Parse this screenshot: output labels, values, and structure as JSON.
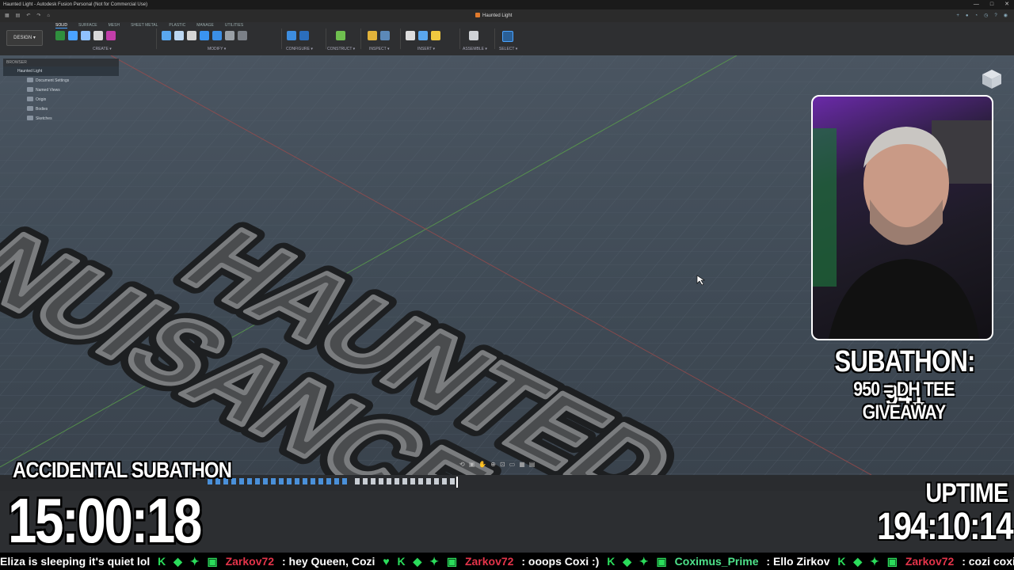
{
  "window": {
    "title": "Haunted Light - Autodesk Fusion Personal (Not for Commercial Use)",
    "controls": [
      "—",
      "□",
      "✕"
    ]
  },
  "tab": {
    "document": "Haunted Light"
  },
  "toolbar": {
    "design_label": "DESIGN ▾",
    "workspace_tabs": [
      "SOLID",
      "SURFACE",
      "MESH",
      "SHEET METAL",
      "PLASTIC",
      "MANAGE",
      "UTILITIES"
    ],
    "groups": [
      "CREATE ▾",
      "MODIFY ▾",
      "CONFIGURE ▾",
      "CONSTRUCT ▾",
      "INSPECT ▾",
      "INSERT ▾",
      "ASSEMBLE ▾",
      "SELECT ▾"
    ]
  },
  "browser": {
    "header": "BROWSER",
    "root": "Haunted Light",
    "items": [
      "Document Settings",
      "Named Views",
      "Origin",
      "Bodies",
      "Sketches"
    ]
  },
  "model": {
    "line1": "HAUNTED",
    "line2": "NUISANCE"
  },
  "overlay": {
    "subathon_count": "SUBATHON: 941",
    "giveaway": "950 = DH TEE GIVEAWAY",
    "accidental_title": "ACCIDENTAL SUBATHON",
    "accidental_timer": "15:00:18",
    "uptime_label": "UPTIME",
    "uptime_value": "194:10:14"
  },
  "ticker": {
    "m0": "Eliza is sleeping it's quiet lol",
    "u1": "Zarkov72",
    "m1": ": hey Queen, Cozi",
    "u2": "Zarkov72",
    "m2": ": ooops Coxi :)",
    "u3": "Coximus_Prime",
    "m3": ": Ello Zirkov",
    "u4": "Zarkov72",
    "m4": ": cozi coxi :)"
  },
  "colors": {
    "accent": "#4aa3ff",
    "viewport_bg": "#44505c",
    "model_gray": "#6e6e6e",
    "ticker_user": "#e4344a",
    "ticker_user_alt": "#4ee28a"
  }
}
